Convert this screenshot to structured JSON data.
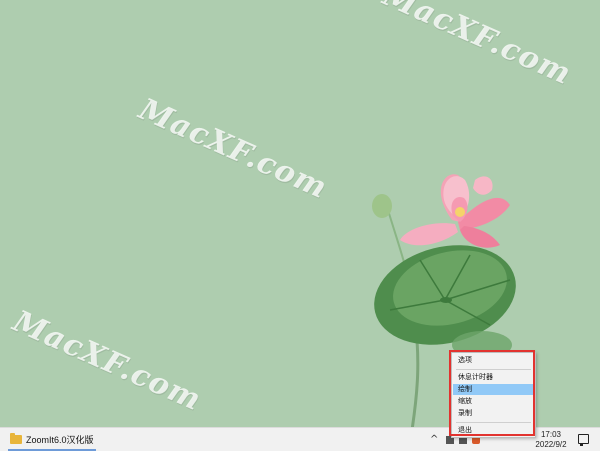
{
  "desktop": {
    "watermarks": [
      "MacXF.com",
      "MacXF.com",
      "MacXF.com"
    ]
  },
  "taskbar": {
    "app_label": "ZoomIt6.0汉化版",
    "chevron": "^",
    "time": "17:03",
    "date": "2022/9/2"
  },
  "context_menu": {
    "items": [
      "选项",
      "休息计时器",
      "绘制",
      "缩放",
      "录制",
      "退出"
    ],
    "highlighted": "绘制"
  },
  "colors": {
    "desktop_bg": "#aecdaf",
    "highlight": "#91c9f7",
    "annotation_border": "#e2332f"
  }
}
